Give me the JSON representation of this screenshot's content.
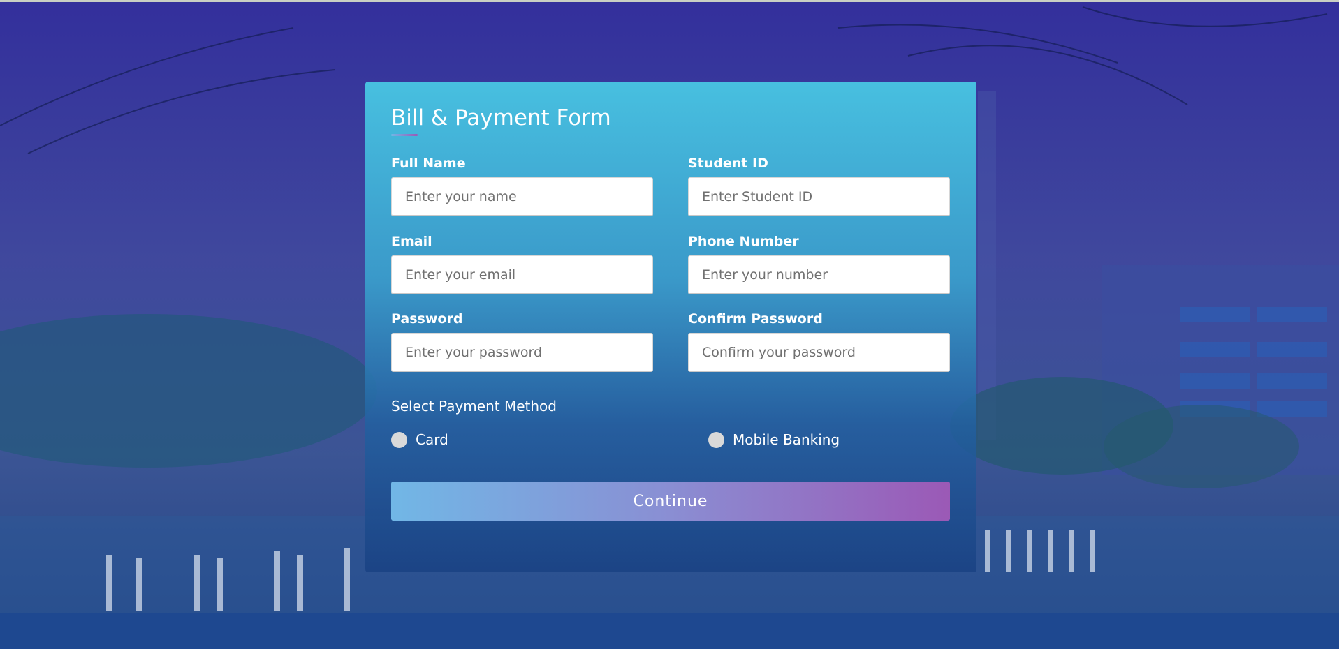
{
  "form": {
    "title": "Bill & Payment Form",
    "fields": [
      {
        "label": "Full Name",
        "placeholder": "Enter your name"
      },
      {
        "label": "Student ID",
        "placeholder": "Enter Student ID"
      },
      {
        "label": "Email",
        "placeholder": "Enter your email"
      },
      {
        "label": "Phone Number",
        "placeholder": "Enter your number"
      },
      {
        "label": "Password",
        "placeholder": "Enter your password"
      },
      {
        "label": "Confirm Password",
        "placeholder": "Confirm your password"
      }
    ],
    "payment_method": {
      "title": "Select Payment Method",
      "options": [
        "Card",
        "Mobile Banking"
      ]
    },
    "submit_label": "Continue"
  },
  "colors": {
    "background": "#28249a",
    "card_top": "#48c4e2",
    "button_start": "#71b7e6",
    "button_end": "#9b59b6",
    "text": "#ffffff"
  }
}
